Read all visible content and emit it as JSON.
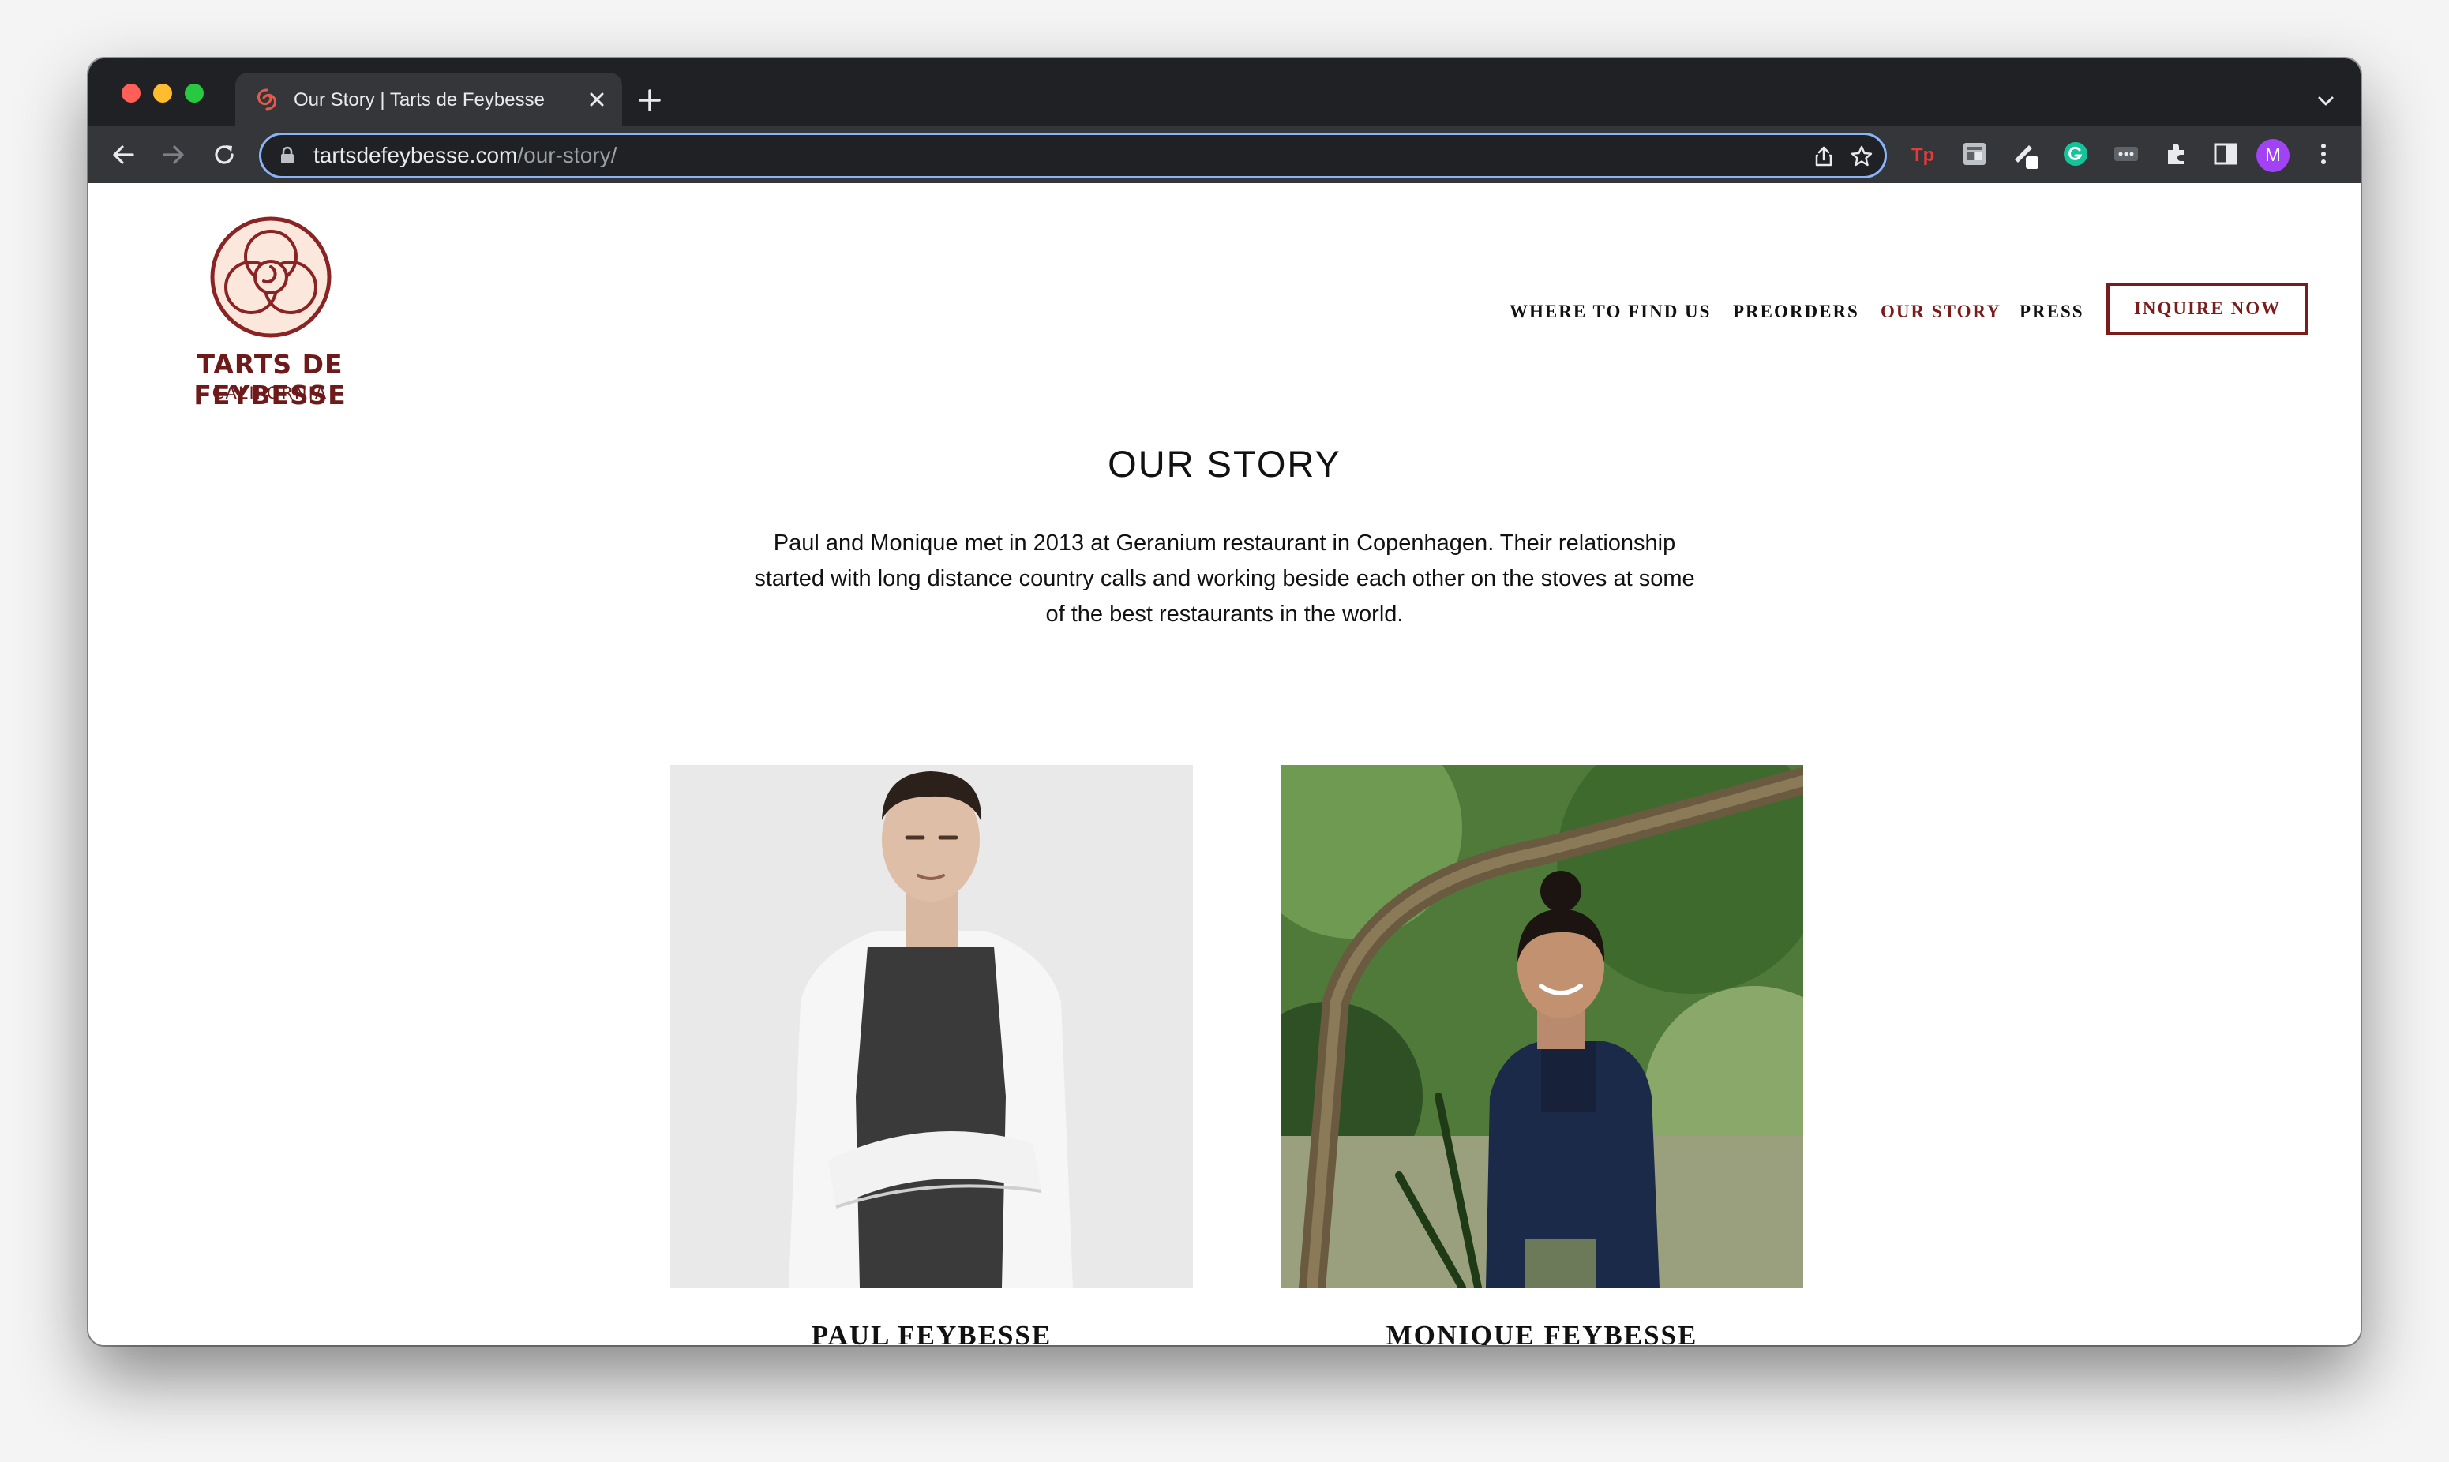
{
  "browser": {
    "tab_title": "Our Story | Tarts de Feybesse",
    "url_host": "tartsdefeybesse.com",
    "url_path": "/our-story/",
    "profile_initial": "M",
    "icons": [
      "back-icon",
      "forward-icon",
      "reload-icon",
      "lock-icon",
      "share-icon",
      "star-icon",
      "extensions-icon",
      "side-panel-icon",
      "menu-icon"
    ]
  },
  "site": {
    "brand_name": "TARTS DE FEYBESSE",
    "brand_sub": "CALIFORNIA",
    "nav": [
      {
        "label": "WHERE TO FIND US"
      },
      {
        "label": "PREORDERS"
      },
      {
        "label": "OUR STORY",
        "active": true
      },
      {
        "label": "PRESS"
      }
    ],
    "cta": "INQUIRE NOW",
    "accent_color": "#7a1c1c"
  },
  "page": {
    "title": "OUR STORY",
    "intro": "Paul and Monique met in 2013 at Geranium restaurant in Copenhagen. Their relationship started with long distance country calls and working beside each other on the stoves at some of the best restaurants in the world.",
    "people": [
      {
        "name": "PAUL FEYBESSE"
      },
      {
        "name": "MONIQUE FEYBESSE"
      }
    ]
  }
}
